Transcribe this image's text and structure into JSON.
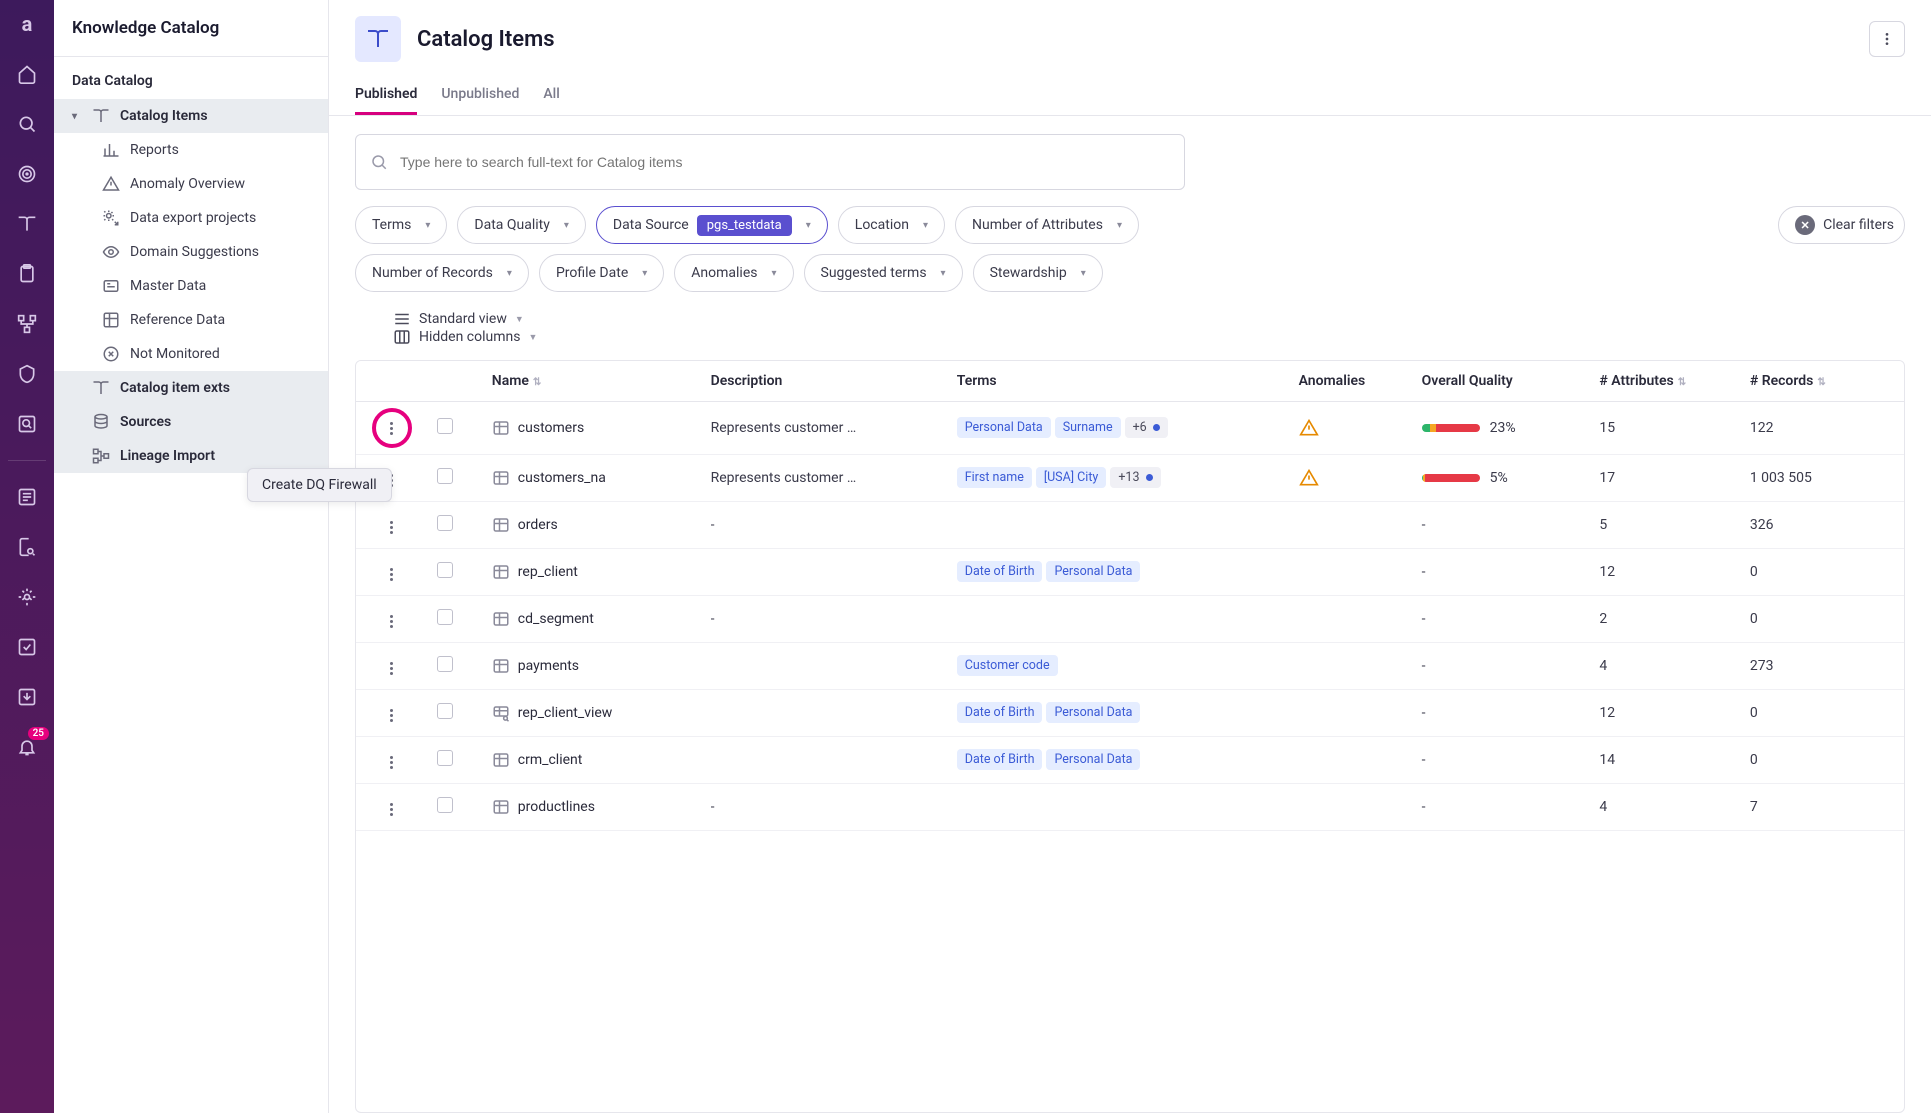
{
  "app_title": "Knowledge Catalog",
  "section_title": "Data Catalog",
  "rail_badge": "25",
  "sidebar": {
    "tree": [
      {
        "label": "Catalog Items",
        "level": 1,
        "active": true,
        "icon": "book"
      },
      {
        "label": "Reports",
        "level": 2,
        "icon": "chart"
      },
      {
        "label": "Anomaly Overview",
        "level": 2,
        "icon": "warning"
      },
      {
        "label": "Data export projects",
        "level": 2,
        "icon": "gear-export"
      },
      {
        "label": "Domain Suggestions",
        "level": 2,
        "icon": "eye"
      },
      {
        "label": "Master Data",
        "level": 2,
        "icon": "card"
      },
      {
        "label": "Reference Data",
        "level": 2,
        "icon": "grid"
      },
      {
        "label": "Not Monitored",
        "level": 2,
        "icon": "x-circle"
      },
      {
        "label": "Catalog item exts",
        "level": 1,
        "icon": "book"
      },
      {
        "label": "Sources",
        "level": 1,
        "icon": "db"
      },
      {
        "label": "Lineage Import",
        "level": 1,
        "icon": "flow"
      }
    ]
  },
  "tooltip_text": "Create DQ Firewall",
  "page": {
    "title": "Catalog Items",
    "tabs": [
      "Published",
      "Unpublished",
      "All"
    ],
    "active_tab": 0,
    "search_placeholder": "Type here to search full-text for Catalog items"
  },
  "filters": {
    "row1": [
      {
        "label": "Terms"
      },
      {
        "label": "Data Quality"
      },
      {
        "label": "Data Source",
        "tag": "pgs_testdata",
        "active": true
      },
      {
        "label": "Location"
      },
      {
        "label": "Number of Attributes"
      }
    ],
    "row2": [
      {
        "label": "Number of Records"
      },
      {
        "label": "Profile Date"
      },
      {
        "label": "Anomalies"
      },
      {
        "label": "Suggested terms"
      },
      {
        "label": "Stewardship"
      }
    ],
    "clear_label": "Clear filters"
  },
  "view": {
    "standard": "Standard view",
    "hidden": "Hidden columns"
  },
  "columns": {
    "name": "Name",
    "description": "Description",
    "terms": "Terms",
    "anomalies": "Anomalies",
    "quality": "Overall Quality",
    "attributes": "# Attributes",
    "records": "# Records"
  },
  "rows": [
    {
      "highlight": true,
      "name": "customers",
      "desc": "Represents customer …",
      "terms": [
        "Personal Data",
        "Surname"
      ],
      "more": "+6",
      "anomaly": true,
      "quality": "23%",
      "qbar": [
        15,
        10,
        75
      ],
      "attrs": "15",
      "records": "122",
      "icon": "table"
    },
    {
      "name": "customers_na",
      "desc": "Represents customer …",
      "terms": [
        "First name",
        "[USA] City"
      ],
      "more": "+13",
      "anomaly": true,
      "quality": "5%",
      "qbar": [
        3,
        2,
        95
      ],
      "attrs": "17",
      "records": "1 003 505",
      "icon": "table"
    },
    {
      "name": "orders",
      "desc": "-",
      "terms": [],
      "anomaly": false,
      "quality": "-",
      "attrs": "5",
      "records": "326",
      "icon": "table"
    },
    {
      "name": "rep_client",
      "desc": "",
      "terms": [
        "Date of Birth",
        "Personal Data"
      ],
      "anomaly": false,
      "quality": "-",
      "attrs": "12",
      "records": "0",
      "icon": "table"
    },
    {
      "name": "cd_segment",
      "desc": "-",
      "terms": [],
      "anomaly": false,
      "quality": "-",
      "attrs": "2",
      "records": "0",
      "icon": "table"
    },
    {
      "name": "payments",
      "desc": "",
      "terms": [
        "Customer code"
      ],
      "anomaly": false,
      "quality": "-",
      "attrs": "4",
      "records": "273",
      "icon": "table"
    },
    {
      "name": "rep_client_view",
      "desc": "",
      "terms": [
        "Date of Birth",
        "Personal Data"
      ],
      "anomaly": false,
      "quality": "-",
      "attrs": "12",
      "records": "0",
      "icon": "view"
    },
    {
      "name": "crm_client",
      "desc": "",
      "terms": [
        "Date of Birth",
        "Personal Data"
      ],
      "anomaly": false,
      "quality": "-",
      "attrs": "14",
      "records": "0",
      "icon": "table"
    },
    {
      "name": "productlines",
      "desc": "-",
      "terms": [],
      "anomaly": false,
      "quality": "-",
      "attrs": "4",
      "records": "7",
      "icon": "table"
    }
  ]
}
